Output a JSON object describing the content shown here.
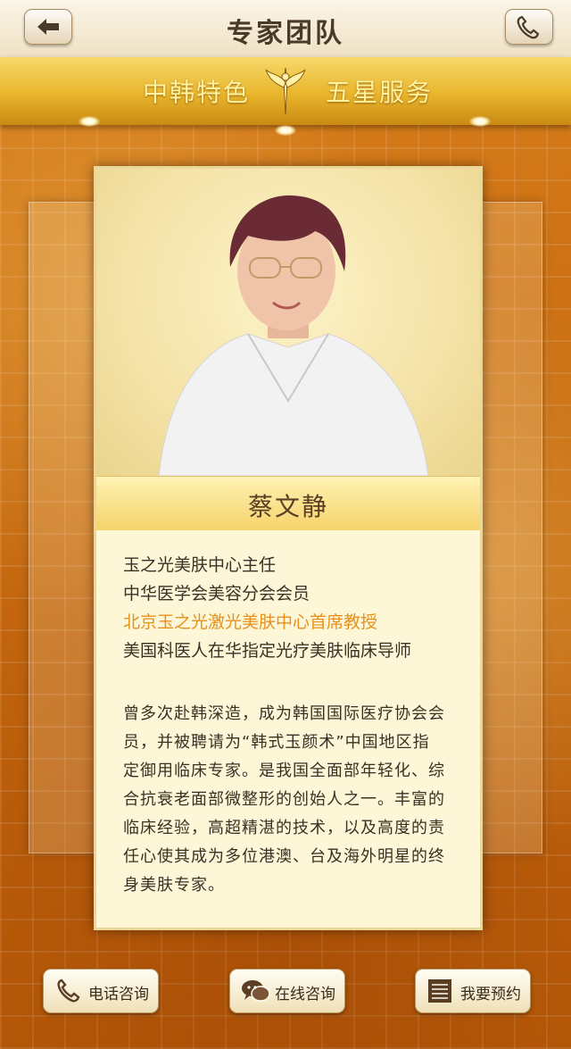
{
  "header": {
    "title": "专家团队",
    "back_icon": "back-arrow-icon",
    "call_icon": "phone-icon"
  },
  "banner": {
    "left": "中韩特色",
    "right": "五星服务",
    "emblem_icon": "emblem-icon"
  },
  "doctor": {
    "name": "蔡文静",
    "titles": [
      "玉之光美肤中心主任",
      "中华医学会美容分会会员",
      "北京玉之光激光美肤中心首席教授",
      "美国科医人在华指定光疗美肤临床导师"
    ],
    "bio_lines": [
      "曾多次赴韩深造，成为韩国国际医疗协会会",
      "员，并被聘请为“韩式玉颜术”中国地区指",
      "定御用临床专家。是我国全面部年轻化、综",
      "合抗衰老面部微整形的创始人之一。丰富的",
      "临床经验，高超精湛的技术，以及高度的责",
      "任心使其成为多位港澳、台及海外明星的终",
      "身美肤专家。"
    ]
  },
  "actions": {
    "phone": "电话咨询",
    "online": "在线咨询",
    "book": "我要预约"
  },
  "colors": {
    "accent": "#e7901c",
    "text": "#3b3024",
    "gold": "#f6d36a"
  }
}
